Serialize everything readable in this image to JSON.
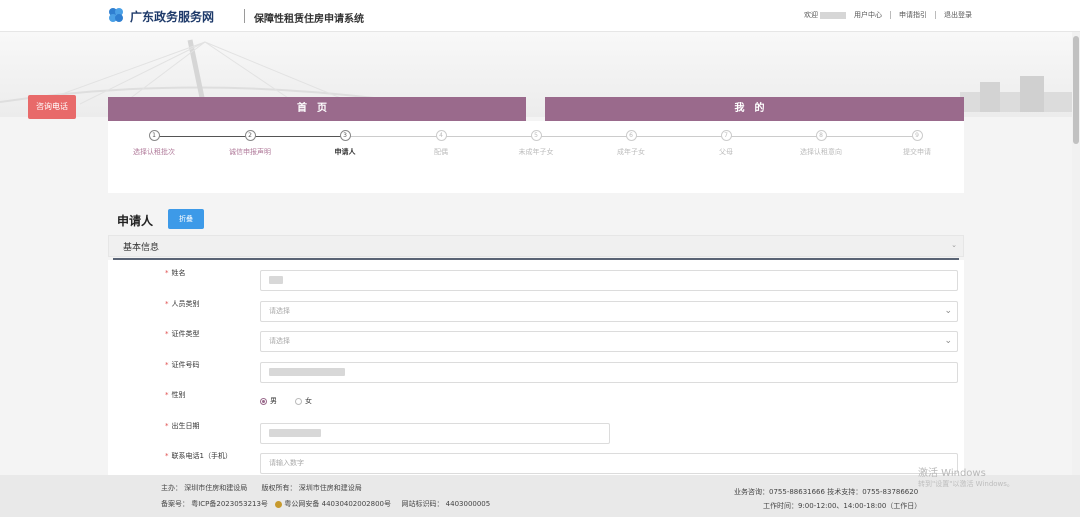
{
  "header": {
    "brand": "广东政务服务网",
    "system_title": "保障性租赁住房申请系统",
    "nav": {
      "welcome": "欢迎",
      "user_center": "用户中心",
      "guide": "申请指引",
      "logout": "退出登录"
    }
  },
  "hotline": "咨询电话",
  "tabs": {
    "home": "首页",
    "mine": "我的"
  },
  "steps": [
    {
      "num": "1",
      "label": "选择认租批次",
      "state": "done"
    },
    {
      "num": "2",
      "label": "诚信申报声明",
      "state": "done"
    },
    {
      "num": "3",
      "label": "申请人",
      "state": "active"
    },
    {
      "num": "4",
      "label": "配偶",
      "state": "pending"
    },
    {
      "num": "5",
      "label": "未成年子女",
      "state": "pending"
    },
    {
      "num": "6",
      "label": "成年子女",
      "state": "pending"
    },
    {
      "num": "7",
      "label": "父母",
      "state": "pending"
    },
    {
      "num": "8",
      "label": "选择认租意向",
      "state": "pending"
    },
    {
      "num": "9",
      "label": "提交申请",
      "state": "pending"
    }
  ],
  "section": {
    "title": "申请人",
    "collapse_button": "折叠"
  },
  "basic_info": "基本信息",
  "form": {
    "name": {
      "label": "姓名"
    },
    "category": {
      "label": "人员类别",
      "placeholder": "请选择"
    },
    "id_type": {
      "label": "证件类型",
      "placeholder": "请选择"
    },
    "id_number": {
      "label": "证件号码"
    },
    "gender": {
      "label": "性别",
      "male": "男",
      "female": "女",
      "selected": "男"
    },
    "birth_date": {
      "label": "出生日期"
    },
    "phone": {
      "label": "联系电话1（手机）",
      "placeholder": "请输入数字"
    }
  },
  "footer": {
    "sponsor": "主办：  深圳市住房和建设局",
    "copyright": "版权所有：  深圳市住房和建设局",
    "icp": "备案号：  粤ICP备2023053213号",
    "police": "粤公网安备 44030402002800号",
    "site_code": "网站标识码：  4403000005",
    "hotline": "业务咨询：0755-88631666 技术支持：0755-83786620",
    "hours": "工作时间：9:00-12:00、14:00-18:00（工作日）"
  },
  "watermark": {
    "title": "激活 Windows",
    "subtitle": "转到\"设置\"以激活 Windows。"
  },
  "colors": {
    "accent": "#9a6a8c",
    "button": "#3d9ae8",
    "hotline": "#e86a6a"
  }
}
